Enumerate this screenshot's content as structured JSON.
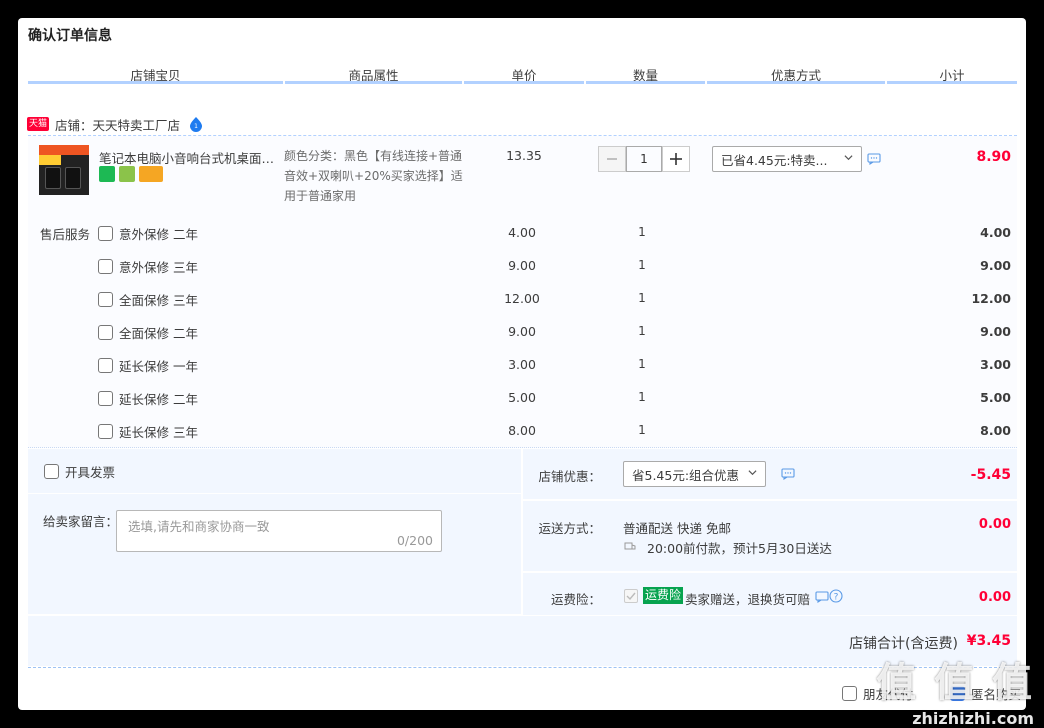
{
  "page": {
    "title": "确认订单信息"
  },
  "columns": [
    "店铺宝贝",
    "商品属性",
    "单价",
    "数量",
    "优惠方式",
    "小计"
  ],
  "shop": {
    "badge": "天猫",
    "name": "店铺：天天特卖工厂店"
  },
  "item": {
    "name": "笔记本电脑小音响台式机桌面usb音箱",
    "attributes": "颜色分类：黑色【有线连接+普通音效+双喇叭+20%买家选择】适用于普通家用",
    "unit_price": "13.35",
    "quantity": "1",
    "discount_option": "已省4.45元:特卖...",
    "subtotal": "8.90"
  },
  "after_sale": {
    "label": "售后服务",
    "services": [
      {
        "name": "意外保修 二年",
        "price": "4.00",
        "qty": "1",
        "subtotal": "4.00"
      },
      {
        "name": "意外保修 三年",
        "price": "9.00",
        "qty": "1",
        "subtotal": "9.00"
      },
      {
        "name": "全面保修 三年",
        "price": "12.00",
        "qty": "1",
        "subtotal": "12.00"
      },
      {
        "name": "全面保修 二年",
        "price": "9.00",
        "qty": "1",
        "subtotal": "9.00"
      },
      {
        "name": "延长保修 一年",
        "price": "3.00",
        "qty": "1",
        "subtotal": "3.00"
      },
      {
        "name": "延长保修 二年",
        "price": "5.00",
        "qty": "1",
        "subtotal": "5.00"
      },
      {
        "name": "延长保修 三年",
        "price": "8.00",
        "qty": "1",
        "subtotal": "8.00"
      }
    ]
  },
  "invoice": {
    "label": "开具发票"
  },
  "message": {
    "label": "给卖家留言：",
    "placeholder": "选填,请先和商家协商一致",
    "counter": "0/200"
  },
  "shop_discount": {
    "label": "店铺优惠：",
    "option": "省5.45元:组合优惠",
    "value": "-5.45"
  },
  "shipping": {
    "label": "运送方式：",
    "method": "普通配送 快递 免邮",
    "eta": "20:00前付款，预计5月30日送达",
    "value": "0.00"
  },
  "insurance": {
    "label": "运费险：",
    "badge": "运费险",
    "text": "卖家赠送，退换货可赔",
    "value": "0.00"
  },
  "total": {
    "label": "店铺合计(含运费)",
    "value": "¥3.45"
  },
  "footer": {
    "friend_pay": "朋友代付",
    "anonymous": "匿名购买"
  },
  "watermark": {
    "big": "值 值 值",
    "small": "zhizhizhi.com"
  },
  "colors": {
    "accent_red": "#ff0036",
    "header_line": "#b2d1ff",
    "panel_bg": "#f2f7ff",
    "tmall_red": "#ff0036",
    "insurance_green": "#07a34f"
  }
}
